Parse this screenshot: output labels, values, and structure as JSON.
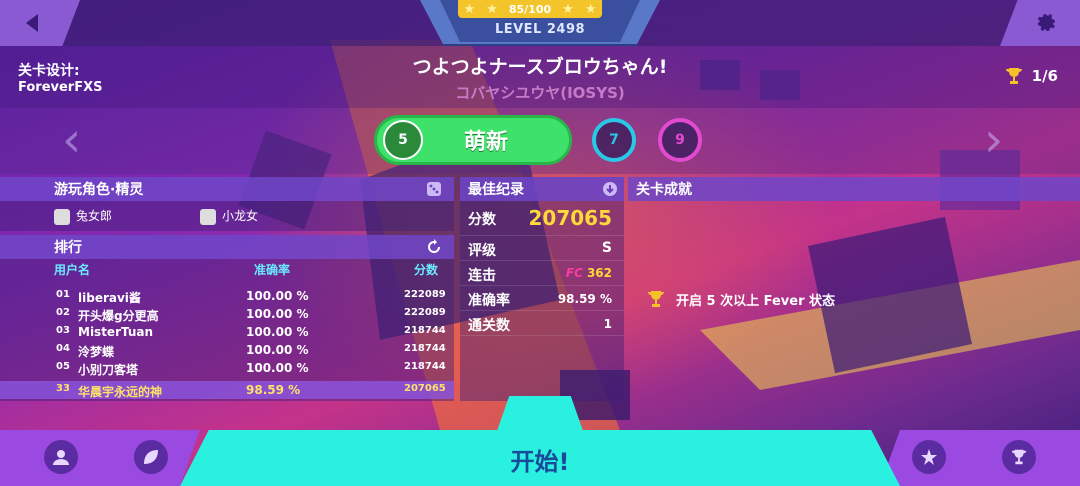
{
  "top": {
    "level_label": "LEVEL 2498",
    "progress_text": "85/100",
    "stars": [
      "★",
      "★",
      "★",
      "★",
      "★"
    ]
  },
  "header": {
    "designer_label": "关卡设计:",
    "designer_name": "ForeverFXS",
    "song_title": "つよつよナースブロウちゃん!",
    "song_artist": "コバヤシユウヤ(IOSYS)",
    "trophy_count": "1/6"
  },
  "difficulty": {
    "selected_level": "5",
    "selected_label": "萌新",
    "hard_level": "7",
    "expert_level": "9"
  },
  "characters": {
    "title": "游玩角色·精灵",
    "character": "兔女郎",
    "sprite": "小龙女"
  },
  "ranking": {
    "title": "排行",
    "col_user": "用户名",
    "col_acc": "准确率",
    "col_score": "分数",
    "rows": [
      {
        "rank": "01",
        "name": "liberavi酱",
        "acc": "100.00 %",
        "score": "222089"
      },
      {
        "rank": "02",
        "name": "开头爆g分更高",
        "acc": "100.00 %",
        "score": "222089"
      },
      {
        "rank": "03",
        "name": "MisterTuan",
        "acc": "100.00 %",
        "score": "218744"
      },
      {
        "rank": "04",
        "name": "泠梦蝶",
        "acc": "100.00 %",
        "score": "218744"
      },
      {
        "rank": "05",
        "name": "小别刀客塔",
        "acc": "100.00 %",
        "score": "218744"
      }
    ],
    "me": {
      "rank": "33",
      "name": "华晨宇永远的神",
      "acc": "98.59 %",
      "score": "207065"
    }
  },
  "best": {
    "title": "最佳纪录",
    "score_label": "分数",
    "score": "207065",
    "grade_label": "评级",
    "grade": "S",
    "combo_label": "连击",
    "combo_badge": "FC",
    "combo": "362",
    "acc_label": "准确率",
    "acc": "98.59 %",
    "clears_label": "通关数",
    "clears": "1"
  },
  "achievements": {
    "title": "关卡成就",
    "item": "开启 5 次以上 Fever 状态"
  },
  "start_label": "开始!",
  "colors": {
    "accent_cyan": "#2af0e0",
    "easy_green": "#3ee26a",
    "hard_blue": "#2ac8e6",
    "expert_pink": "#e24ad0",
    "gold": "#ffd93a"
  }
}
